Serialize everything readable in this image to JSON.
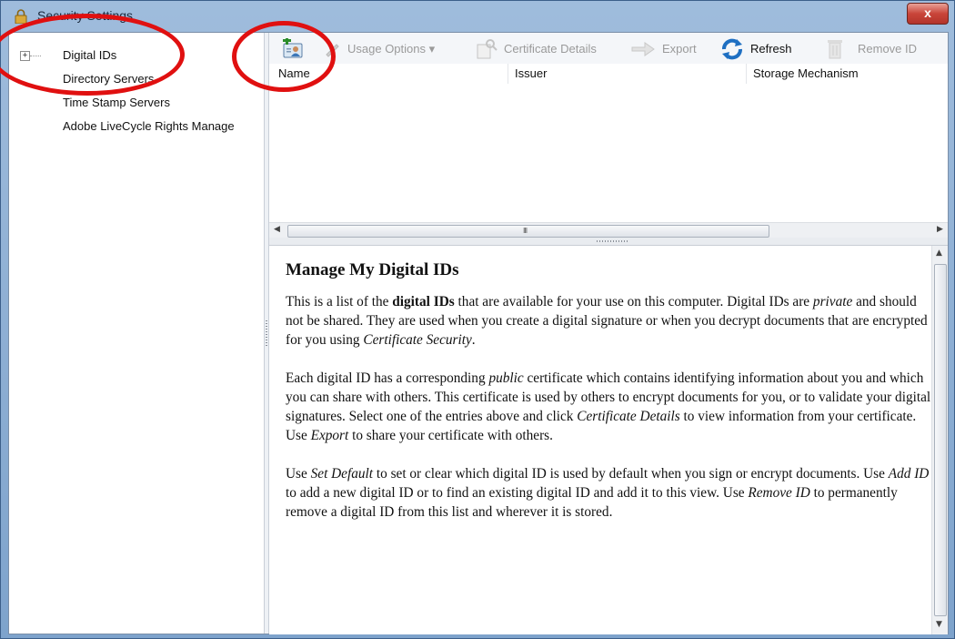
{
  "window": {
    "title": "Security Settings",
    "close_label": "x"
  },
  "tree": {
    "items": [
      {
        "label": "Digital IDs",
        "expander": "+"
      },
      {
        "label": "Directory Servers"
      },
      {
        "label": "Time Stamp Servers"
      },
      {
        "label": "Adobe LiveCycle Rights Manage"
      }
    ]
  },
  "toolbar": {
    "add_id_icon": "add-id-icon",
    "usage_options": "Usage Options",
    "usage_options_caret": "▾",
    "certificate_details": "Certificate Details",
    "export": "Export",
    "refresh": "Refresh",
    "remove_id": "Remove ID"
  },
  "list": {
    "columns": [
      "Name",
      "Issuer",
      "Storage Mechanism"
    ],
    "rows": [],
    "scroll_grip": "III"
  },
  "help": {
    "title": "Manage My Digital IDs",
    "p1": {
      "a": "This is a list of the ",
      "b": "digital IDs",
      "c": " that are available for your use on this computer. Digital IDs are ",
      "d": "private",
      "e": " and should not be shared. They are used when you create a digital signature or when you decrypt documents that are encrypted for you using ",
      "f": "Certificate Security",
      "g": "."
    },
    "p2": {
      "a": "Each digital ID has a corresponding ",
      "b": "public",
      "c": " certificate which contains identifying information about you and which you can share with others. This certificate is used by others to encrypt documents for you, or to validate your digital signatures. Select one of the entries above and click ",
      "d": "Certificate Details",
      "e": " to view information from your certificate. Use ",
      "f": "Export",
      "g": " to share your certificate with others."
    },
    "p3": {
      "a": "Use ",
      "b": "Set Default",
      "c": " to set or clear which digital ID is used by default when you sign or encrypt documents. Use ",
      "d": "Add ID",
      "e": " to add a new digital ID or to find an existing digital ID and add it to this view. Use ",
      "f": "Remove ID",
      "g": " to permanently remove a digital ID from this list and wherever it is stored."
    }
  },
  "colors": {
    "annotation": "#e01010",
    "refresh_accent": "#1e6fc2"
  }
}
